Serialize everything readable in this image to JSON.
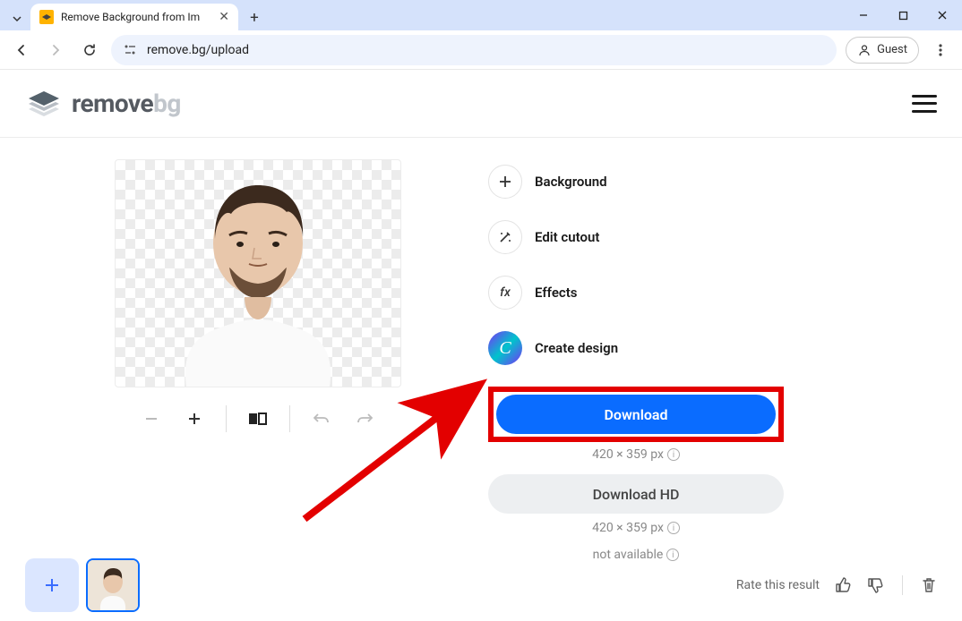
{
  "browser": {
    "tab_title": "Remove Background from Im",
    "url": "remove.bg/upload",
    "guest_label": "Guest"
  },
  "header": {
    "logo_dark": "remove",
    "logo_light": "bg"
  },
  "tools": {
    "background": "Background",
    "edit_cutout": "Edit cutout",
    "effects": "Effects",
    "create_design": "Create design"
  },
  "download": {
    "primary_label": "Download",
    "primary_size": "420 × 359 px",
    "hd_label": "Download HD",
    "hd_size": "420 × 359 px",
    "hd_availability": "not available"
  },
  "footer": {
    "rate_label": "Rate this result"
  }
}
